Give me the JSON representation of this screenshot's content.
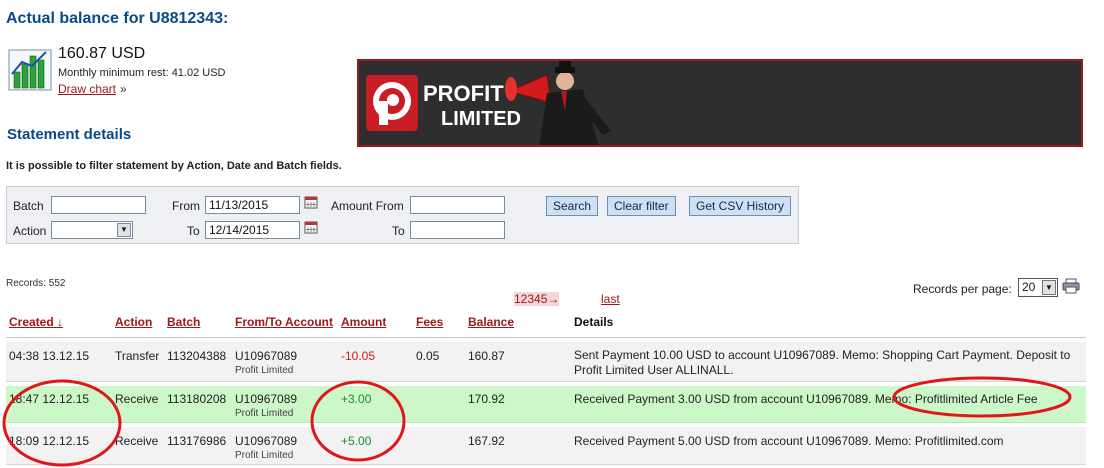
{
  "header": {
    "title": "Actual balance for U8812343:",
    "amount": "160.87 USD",
    "monthly_min": "Monthly minimum rest: 41.02 USD",
    "draw_chart": "Draw chart",
    "raquo": "»"
  },
  "banner": {
    "logo_letter": "P",
    "line1": "PROFIT",
    "line2": "LIMITED"
  },
  "statement": {
    "title": "Statement details",
    "hint": "It is possible to filter statement by Action, Date and Batch fields."
  },
  "filter": {
    "batch_label": "Batch",
    "batch_value": "",
    "action_label": "Action",
    "action_value": "",
    "from_label": "From",
    "from_value": "11/13/2015",
    "to_label": "To",
    "to_value": "12/14/2015",
    "amount_from_label": "Amount From",
    "amount_from_value": "",
    "amount_to_label": "To",
    "amount_to_value": "",
    "search_btn": "Search",
    "clear_btn": "Clear filter",
    "csv_btn": "Get CSV History"
  },
  "records": {
    "count": "Records: 552",
    "pages": "12345→",
    "last": "last",
    "per_page_label": "Records per page:",
    "per_page_value": "20"
  },
  "table": {
    "headers": {
      "created": "Created ↓",
      "action": "Action",
      "batch": "Batch",
      "account": "From/To Account",
      "amount": "Amount",
      "fees": "Fees",
      "balance": "Balance",
      "details": "Details"
    },
    "rows": [
      {
        "created": "04:38 13.12.15",
        "action": "Transfer",
        "batch": "113204388",
        "account": "U10967089",
        "account_name": "Profit Limited",
        "amount": "-10.05",
        "fees": "0.05",
        "balance": "160.87",
        "details": "Sent Payment 10.00 USD to account U10967089. Memo: Shopping Cart Payment. Deposit to Profit Limited User ALLINALL."
      },
      {
        "created": "18:47 12.12.15",
        "action": "Receive",
        "batch": "113180208",
        "account": "U10967089",
        "account_name": "Profit Limited",
        "amount": "+3.00",
        "fees": "",
        "balance": "170.92",
        "details": "Received Payment 3.00 USD from account U10967089. Memo: Profitlimited Article Fee"
      },
      {
        "created": "18:09 12.12.15",
        "action": "Receive",
        "batch": "113176986",
        "account": "U10967089",
        "account_name": "Profit Limited",
        "amount": "+5.00",
        "fees": "",
        "balance": "167.92",
        "details": "Received Payment 5.00 USD from account U10967089. Memo: Profitlimited.com"
      }
    ]
  },
  "colors": {
    "link_red": "#a01818",
    "title_blue": "#0b4a8a",
    "highlight_green": "#ccf7c9",
    "annotation_red": "#e0161b"
  },
  "icons": {
    "chart": "bar-chart-icon",
    "calendar": "calendar-icon",
    "print": "printer-icon"
  }
}
